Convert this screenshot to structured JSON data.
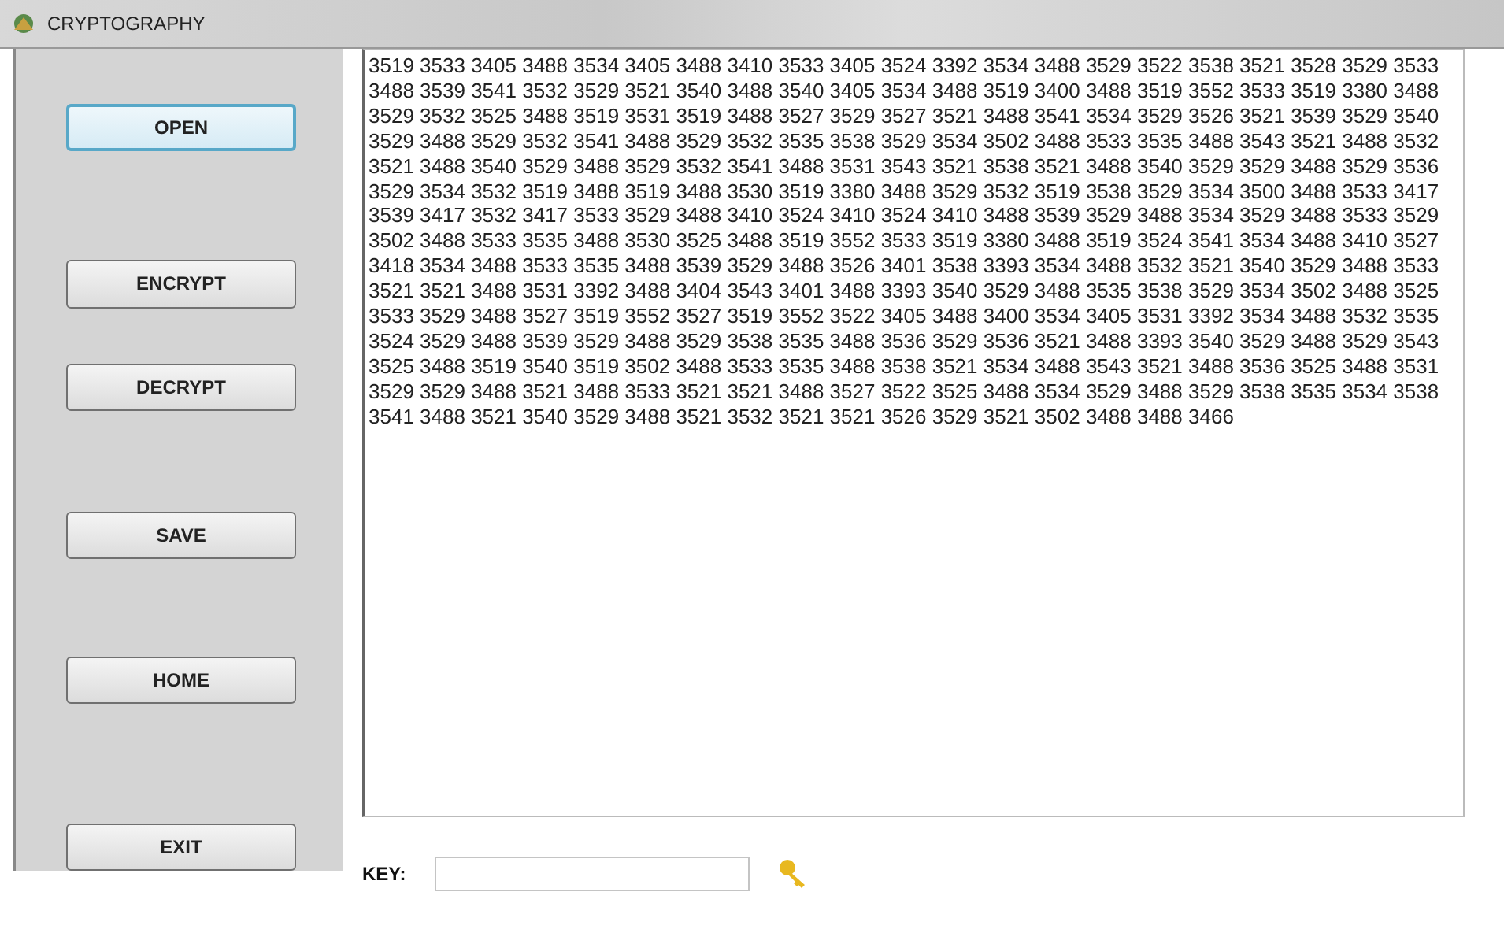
{
  "window": {
    "title": "CRYPTOGRAPHY"
  },
  "buttons": [
    {
      "label": "OPEN",
      "focused": true
    },
    {
      "label": "ENCRYPT",
      "focused": false
    },
    {
      "label": "DECRYPT",
      "focused": false
    },
    {
      "label": "SAVE",
      "focused": false
    },
    {
      "label": "HOME",
      "focused": false
    },
    {
      "label": "EXIT",
      "focused": false
    }
  ],
  "output_lines": [
    "3519 3533 3405 3488 3534 3405 3488 3410 3533 3405 3524 3392 3534 3488 3529 3522 3538 3521 3528 3529 3533",
    "3488 3539 3541 3532 3529 3521 3540 3488 3540 3405 3534 3488 3519 3400 3488 3519 3552 3533 3519 3380 3488",
    "3529 3532 3525 3488 3519 3531 3519 3488 3527 3529 3527 3521 3488 3541 3534 3529 3526 3521 3539 3529 3540",
    "3529 3488 3529 3532 3541 3488 3529 3532 3535 3538 3529 3534 3502 3488 3533 3535 3488 3543 3521 3488 3532",
    "3521 3488 3540 3529 3488 3529 3532 3541 3488 3531 3543 3521 3538 3521 3488 3540 3529 3529 3488 3529 3536",
    "3529 3534 3532 3519 3488 3519 3488 3530 3519 3380 3488 3529 3532 3519 3538 3529 3534 3500 3488 3533 3417",
    "3539 3417 3532 3417 3533 3529 3488 3410 3524 3410 3524 3410 3488 3539 3529 3488 3534 3529 3488 3533 3529",
    "3502 3488 3533 3535 3488 3530 3525 3488 3519 3552 3533 3519 3380 3488 3519 3524 3541 3534 3488 3410 3527",
    "3418 3534 3488 3533 3535 3488 3539 3529 3488 3526 3401 3538 3393 3534 3488 3532 3521 3540 3529 3488 3533",
    "3521 3521 3488 3531 3392 3488 3404 3543 3401 3488 3393 3540 3529 3488 3535 3538 3529 3534 3502 3488 3525",
    "3533 3529 3488 3527 3519 3552 3527 3519 3552 3522 3405 3488 3400 3534 3405 3531 3392 3534 3488 3532 3535",
    "3524 3529 3488 3539 3529 3488 3529 3538 3535 3488 3536 3529 3536 3521 3488 3393 3540 3529 3488 3529 3543",
    "3525 3488 3519 3540 3519 3502 3488 3533 3535 3488 3538 3521 3534 3488 3543 3521 3488 3536 3525 3488 3531",
    "3529 3529 3488 3521 3488 3533 3521 3521 3488 3527 3522 3525 3488 3534 3529 3488 3529 3538 3535 3534 3538",
    "3541 3488 3521 3540 3529 3488 3521 3532 3521 3521 3526 3529 3521 3502 3488 3488 3466"
  ],
  "key": {
    "label": "KEY:"
  }
}
